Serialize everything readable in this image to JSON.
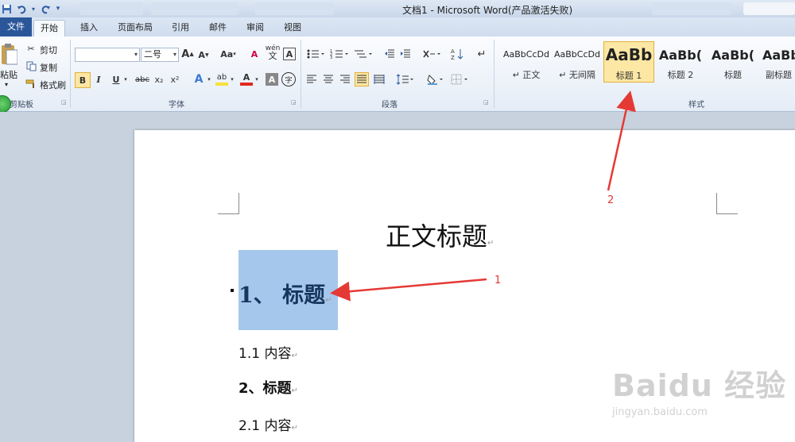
{
  "window": {
    "title": "文档1 - Microsoft Word(产品激活失败)"
  },
  "quick_access": {
    "icons": [
      "save-icon",
      "undo-icon",
      "redo-icon",
      "customize-icon"
    ]
  },
  "tabs": [
    {
      "label": "文件"
    },
    {
      "label": "开始"
    },
    {
      "label": "插入"
    },
    {
      "label": "页面布局"
    },
    {
      "label": "引用"
    },
    {
      "label": "邮件"
    },
    {
      "label": "审阅"
    },
    {
      "label": "视图"
    }
  ],
  "clipboard": {
    "paste_label": "粘贴",
    "cut_label": "剪切",
    "copy_label": "复制",
    "format_painter_label": "格式刷",
    "group_label": "剪贴板"
  },
  "font": {
    "font_name": "",
    "font_size": "二号",
    "grow_glyph": "A",
    "shrink_glyph": "A",
    "change_case_glyph": "Aa",
    "clear_glyph": "A",
    "phonetic_glyph": "wén",
    "phonetic_glyph2": "文",
    "border_glyph": "A",
    "bold_glyph": "B",
    "italic_glyph": "I",
    "underline_glyph": "U",
    "strike_glyph": "abc",
    "sub_glyph": "x₂",
    "sup_glyph": "x²",
    "effects_glyph": "A",
    "highlight_glyph": "ab",
    "color_glyph": "A",
    "shade_glyph": "A",
    "enclose_glyph": "字",
    "group_label": "字体",
    "accent_red": "#e02b20",
    "accent_yellow": "#f5e23b"
  },
  "paragraph": {
    "group_label": "段落"
  },
  "styles": {
    "group_label": "样式",
    "items": [
      {
        "preview": "AaBbCcDd",
        "name": "↵ 正文"
      },
      {
        "preview": "AaBbCcDd",
        "name": "↵ 无间隔"
      },
      {
        "preview": "AaBb",
        "name": "标题 1"
      },
      {
        "preview": "AaBb(",
        "name": "标题 2"
      },
      {
        "preview": "AaBb(",
        "name": "标题"
      },
      {
        "preview": "AaBb",
        "name": "副标题"
      }
    ]
  },
  "document": {
    "title": "正文标题",
    "heading1": "1、 标题",
    "line_1_1": "1.1 内容",
    "heading2": "2、标题",
    "line_2_1": "2.1 内容",
    "para_mark": "↵"
  },
  "annotations": {
    "label_1": "1",
    "label_2": "2",
    "color": "#e53935"
  },
  "watermark": {
    "logo": "Baidu 经验",
    "url": "jingyan.baidu.com"
  }
}
